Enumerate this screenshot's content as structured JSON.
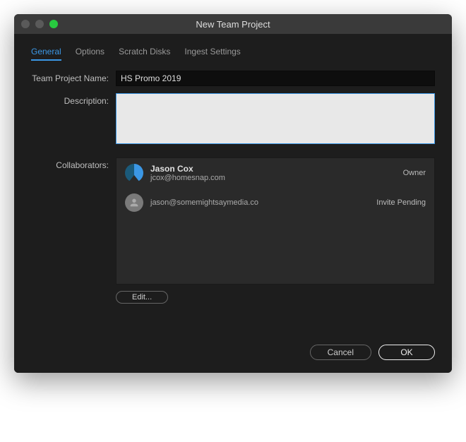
{
  "window": {
    "title": "New Team Project"
  },
  "tabs": {
    "general": "General",
    "options": "Options",
    "scratch_disks": "Scratch Disks",
    "ingest_settings": "Ingest Settings"
  },
  "form": {
    "project_name_label": "Team Project Name:",
    "project_name_value": "HS Promo 2019",
    "description_label": "Description:",
    "description_value": "",
    "collaborators_label": "Collaborators:",
    "edit_button": "Edit..."
  },
  "collaborators": [
    {
      "name": "Jason Cox",
      "email": "jcox@homesnap.com",
      "status": "Owner",
      "avatar": "colored"
    },
    {
      "name": "",
      "email": "jason@somemightsaymedia.co",
      "status": "Invite Pending",
      "avatar": "grey"
    }
  ],
  "footer": {
    "cancel": "Cancel",
    "ok": "OK"
  }
}
